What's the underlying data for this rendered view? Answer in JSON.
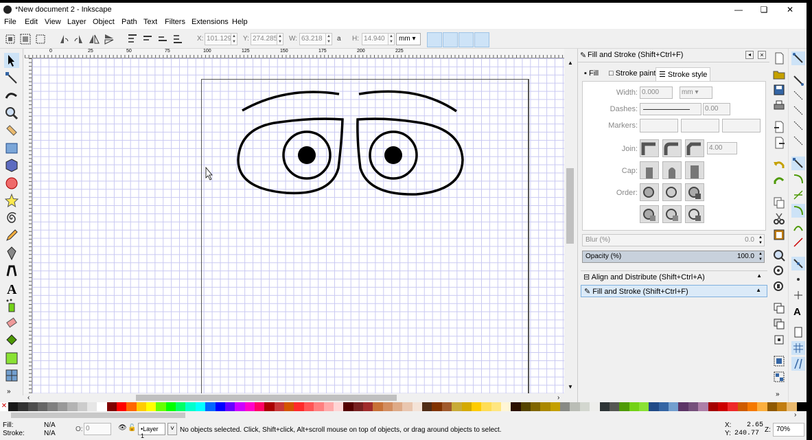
{
  "window": {
    "title": "*New document 2 - Inkscape"
  },
  "menu": [
    "File",
    "Edit",
    "View",
    "Layer",
    "Object",
    "Path",
    "Text",
    "Filters",
    "Extensions",
    "Help"
  ],
  "toolbar": {
    "x_label": "X:",
    "x_value": "101.129",
    "y_label": "Y:",
    "y_value": "274.285",
    "w_label": "W:",
    "w_value": "63.218",
    "h_label": "H:",
    "h_value": "14.940",
    "unit": "mm"
  },
  "ruler": {
    "h_ticks": [
      "0",
      "25",
      "50",
      "75",
      "100",
      "125",
      "150",
      "175",
      "200",
      "225"
    ]
  },
  "dock": {
    "title": "Fill and Stroke (Shift+Ctrl+F)",
    "tabs": [
      "Fill",
      "Stroke paint",
      "Stroke style"
    ],
    "width_label": "Width:",
    "width_value": "0.000",
    "width_unit": "mm",
    "dashes_label": "Dashes:",
    "dashes_value": "0.00",
    "markers_label": "Markers:",
    "join_label": "Join:",
    "join_value": "4.00",
    "cap_label": "Cap:",
    "order_label": "Order:",
    "blur_label": "Blur (%)",
    "blur_value": "0.0",
    "opacity_label": "Opacity (%)",
    "opacity_value": "100.0",
    "items": [
      "Align and Distribute (Shift+Ctrl+A)",
      "Fill and Stroke (Shift+Ctrl+F)"
    ]
  },
  "status": {
    "fill_label": "Fill:",
    "fill_value": "N/A",
    "stroke_label": "Stroke:",
    "stroke_value": "N/A",
    "opacity_label": "O:",
    "opacity_value": "0",
    "layer": "•Layer 1",
    "message": "No objects selected. Click, Shift+click, Alt+scroll mouse on top of objects, or drag around objects to select.",
    "x_label": "X:",
    "x_value": "2.65",
    "y_label": "Y:",
    "y_value": "240.77",
    "z_label": "Z:",
    "zoom": "70%"
  },
  "palette": [
    "#1a1a1a",
    "#333333",
    "#4d4d4d",
    "#666666",
    "#808080",
    "#999999",
    "#b3b3b3",
    "#cccccc",
    "#e6e6e6",
    "#ffffff",
    "#800000",
    "#ff0000",
    "#ff6600",
    "#ffcc00",
    "#ffff00",
    "#66ff00",
    "#00ff00",
    "#00ff66",
    "#00ffcc",
    "#00ffff",
    "#0066ff",
    "#0000ff",
    "#6600ff",
    "#cc00ff",
    "#ff00cc",
    "#ff0066",
    "#aa0000",
    "#c83737",
    "#d45500",
    "#ff2a2a",
    "#ff5555",
    "#ff8080",
    "#ffaaaa",
    "#ffd5d5",
    "#550000",
    "#782121",
    "#a02c2c",
    "#c87137",
    "#d38d5f",
    "#deaa87",
    "#e9c6af",
    "#f4e3d7",
    "#502d16",
    "#803300",
    "#a05a2c",
    "#c8ab37",
    "#d4aa00",
    "#ffcc00",
    "#ffdd55",
    "#ffe680",
    "#fff6d5",
    "#2b1100",
    "#554400",
    "#806600",
    "#aa8800",
    "#c4a000",
    "#888a85",
    "#babdb6",
    "#d3d7cf",
    "#eeeeec",
    "#2e3436",
    "#555753",
    "#4e9a06",
    "#73d216",
    "#8ae234",
    "#204a87",
    "#3465a4",
    "#729fcf",
    "#5c3566",
    "#75507b",
    "#ad7fa8",
    "#a40000",
    "#cc0000",
    "#ef2929",
    "#ce5c00",
    "#f57900",
    "#fcaf3e",
    "#8f5902",
    "#c17d11",
    "#e9b96e",
    "#000000"
  ]
}
